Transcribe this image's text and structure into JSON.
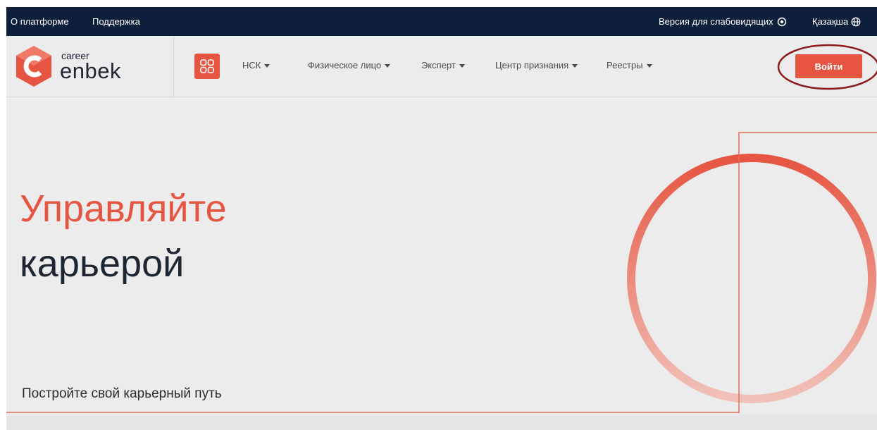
{
  "topbar": {
    "about": "О платформе",
    "support": "Поддержка",
    "accessibility": "Версия для слабовидящих",
    "language": "Қазақша"
  },
  "logo": {
    "small": "career",
    "big": "enbek"
  },
  "nav": [
    {
      "label": "НСК"
    },
    {
      "label": "Физическое лицо"
    },
    {
      "label": "Эксперт"
    },
    {
      "label": "Центр признания"
    },
    {
      "label": "Реестры"
    }
  ],
  "login_label": "Войти",
  "hero": {
    "line1": "Управляйте",
    "line2": "карьерой",
    "subtitle": "Постройте свой карьерный путь"
  },
  "colors": {
    "accent": "#e65541",
    "topbar": "#0d1f3a",
    "background": "#ececec",
    "annotation": "#8b1a1a"
  }
}
